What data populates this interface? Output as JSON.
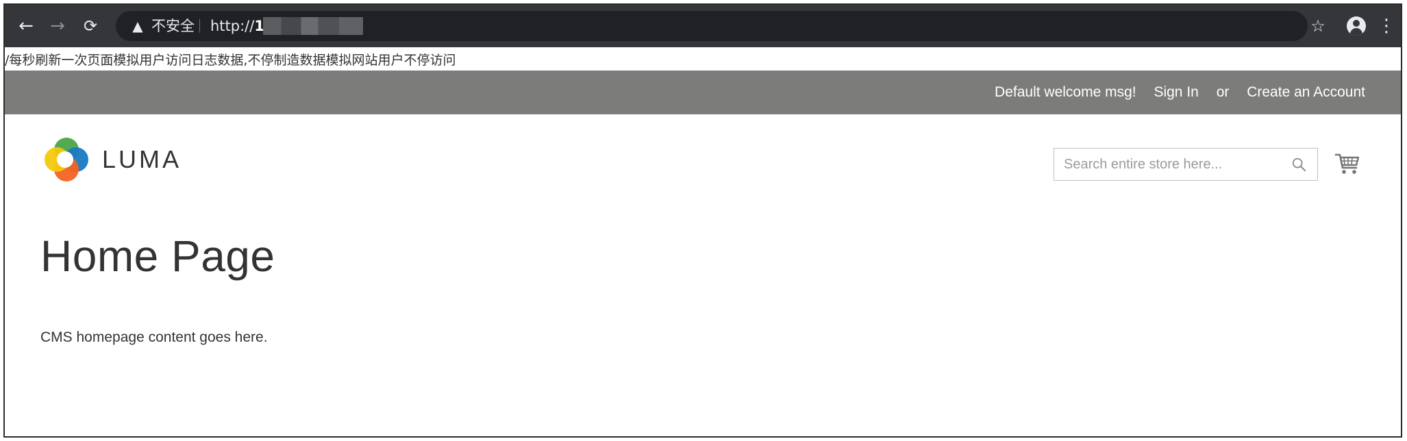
{
  "browser": {
    "back_icon": "arrow-left-icon",
    "forward_icon": "arrow-right-icon",
    "reload_icon": "reload-icon",
    "security_label": "不安全",
    "url_prefix": "http://",
    "url_host_visible": "1",
    "star_icon": "star-icon",
    "profile_icon": "profile-icon",
    "menu_icon": "kebab-menu-icon"
  },
  "injected_text": "/每秒刷新一次页面模拟用户访问日志数据,不停制造数据模拟网站用户不停访问",
  "header": {
    "welcome": "Default welcome msg!",
    "sign_in": "Sign In",
    "or": "or",
    "create_account": "Create an Account"
  },
  "logo": {
    "text": "LUMA",
    "colors": [
      "#f26322",
      "#1979c3",
      "#4aa547",
      "#f6c90e"
    ]
  },
  "search": {
    "placeholder": "Search entire store here..."
  },
  "page": {
    "title": "Home Page",
    "content": "CMS homepage content goes here."
  }
}
